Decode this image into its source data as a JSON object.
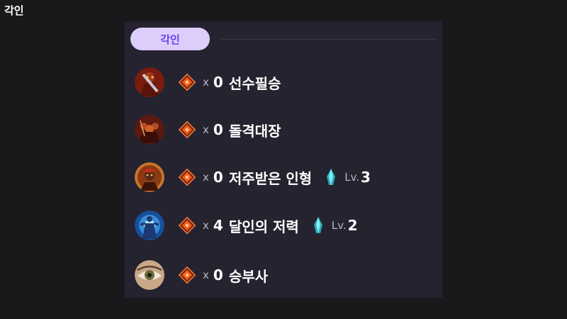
{
  "page": {
    "title": "각인"
  },
  "panel": {
    "header_label": "각인",
    "items": [
      {
        "portrait": "warrior-portrait-icon",
        "multiplier": "x",
        "count": "0",
        "name": "선수필승"
      },
      {
        "portrait": "charging-warriors-portrait-icon",
        "multiplier": "x",
        "count": "0",
        "name": "돌격대장"
      },
      {
        "portrait": "cursed-doll-portrait-icon",
        "multiplier": "x",
        "count": "0",
        "name": "저주받은 인형",
        "level_label": "Lv.",
        "level": "3"
      },
      {
        "portrait": "master-strength-portrait-icon",
        "multiplier": "x",
        "count": "4",
        "name": "달인의 저력",
        "level_label": "Lv.",
        "level": "2"
      },
      {
        "portrait": "eye-portrait-icon",
        "multiplier": "x",
        "count": "0",
        "name": "승부사"
      }
    ]
  },
  "colors": {
    "panel_bg": "#24232f",
    "pill_bg": "#dccdfb",
    "pill_text": "#6a3ff0",
    "gem": "#e8461a",
    "crystal": "#4fd6e0"
  }
}
